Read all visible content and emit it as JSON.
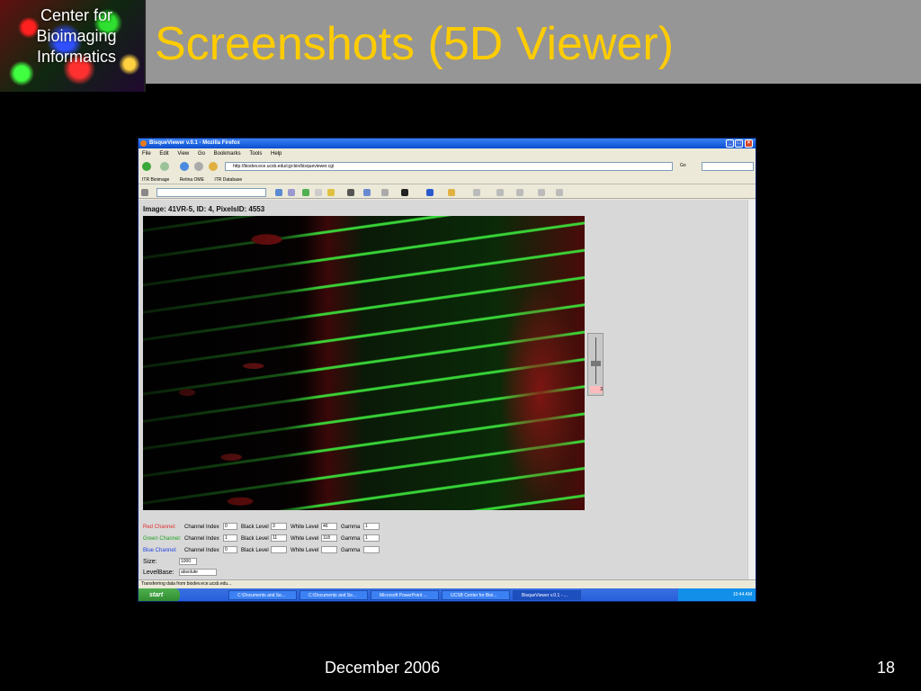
{
  "slide": {
    "logo_text": [
      "Center for",
      "Bioimaging",
      "Informatics"
    ],
    "title": "Screenshots (5D Viewer)",
    "footer_date": "December 2006",
    "page_number": "18"
  },
  "browser": {
    "window_title": "BisqueViewer v.0.1 - Mozilla Firefox",
    "menu": [
      "File",
      "Edit",
      "View",
      "Go",
      "Bookmarks",
      "Tools",
      "Help"
    ],
    "url": "http://biodev.ece.ucsb.edu/cgi-bin/bisqueviewer.cgi",
    "go_label": "Go",
    "bookmarks": [
      "ITR Bioimage",
      "Retina OME",
      "ITR Database"
    ],
    "status": "Transferring data from biodev.ece.ucsb.edu..."
  },
  "viewer": {
    "image_label": "Image: 41VR-5, ID: 4, PixelsID: 4553",
    "z_value": "3",
    "channels": [
      {
        "name": "Red Channel:",
        "color": "#e03030",
        "index": "0",
        "black": "3",
        "white": "46",
        "gamma": "1"
      },
      {
        "name": "Green Channel:",
        "color": "#20a020",
        "index": "1",
        "black": "11",
        "white": "118",
        "gamma": "1"
      },
      {
        "name": "Blue Channel:",
        "color": "#2040e0",
        "index": "0",
        "black": "",
        "white": "",
        "gamma": ""
      }
    ],
    "labels": {
      "channel_index": "Channel Index",
      "black_level": "Black Level",
      "white_level": "White Level",
      "gamma": "Gamma"
    },
    "size_label": "Size:",
    "size_value": "1000",
    "levelbase_label": "LevelBase:",
    "levelbase_value": "absolute"
  },
  "taskbar": {
    "start": "start",
    "tasks": [
      "C:\\Documents and Se...",
      "C:\\Documents and Se...",
      "Microsoft PowerPoint ...",
      "UCSB Center for Bioi...",
      "BisqueViewer v.0.1 - ..."
    ],
    "clock": "10:44 AM"
  }
}
